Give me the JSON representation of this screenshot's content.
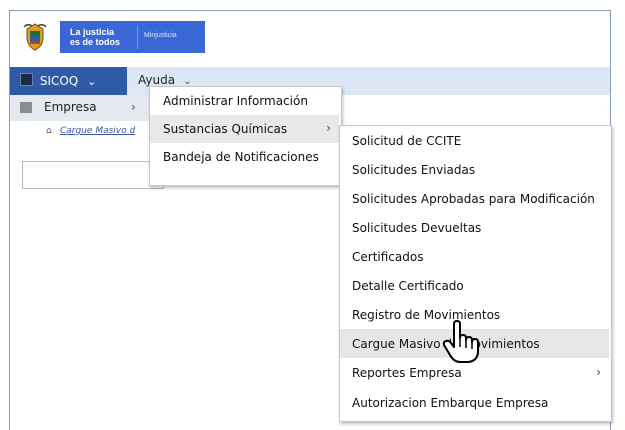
{
  "header": {
    "logo_line1": "La justicia",
    "logo_line2": "es de todos",
    "logo_brand": "Minjusticia"
  },
  "navbar": {
    "main_menu": "SICOQ",
    "main_chevron": "⌄",
    "help_menu": "Ayuda",
    "help_chevron": "⌄"
  },
  "submenu_level1": {
    "label": "Empresa",
    "chevron": "›"
  },
  "breadcrumb": {
    "text": "Cargue Masivo d"
  },
  "menu_level2": [
    {
      "label": "Administrar Información"
    },
    {
      "label": "Sustancias Químicas",
      "chevron": "›"
    },
    {
      "label": "Bandeja de Notificaciones"
    }
  ],
  "menu_level3": [
    {
      "label": "Solicitud de CCITE"
    },
    {
      "label": "Solicitudes Enviadas"
    },
    {
      "label": "Solicitudes Aprobadas para Modificación"
    },
    {
      "label": "Solicitudes Devueltas"
    },
    {
      "label": "Certificados"
    },
    {
      "label": "Detalle Certificado"
    },
    {
      "label": "Registro de Movimientos"
    },
    {
      "label": "Cargue Masivo de Movimientos"
    },
    {
      "label": "Reportes Empresa",
      "chevron": "›"
    },
    {
      "label": "Autorizacion Embarque Empresa"
    }
  ],
  "colors": {
    "navbar_bg": "#dde6f5",
    "sicoq_bg": "#2f5aa6",
    "logo_bg": "#3a67d6",
    "highlight": "#e6e6e6"
  }
}
